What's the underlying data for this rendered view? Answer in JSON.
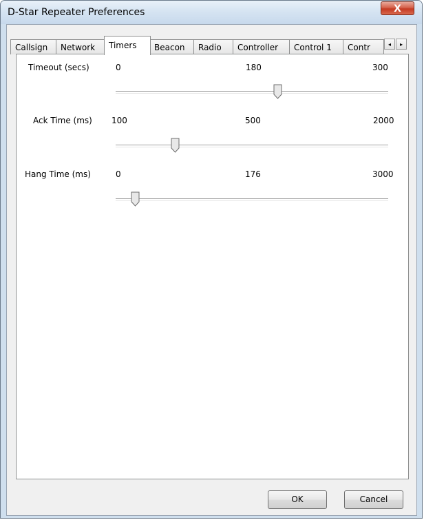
{
  "window": {
    "title": "D-Star Repeater Preferences"
  },
  "title_bar": {
    "close_glyph": "X"
  },
  "tabs": [
    {
      "label": "Callsign"
    },
    {
      "label": "Network"
    },
    {
      "label": "Timers"
    },
    {
      "label": "Beacon"
    },
    {
      "label": "Radio"
    },
    {
      "label": "Controller"
    },
    {
      "label": "Control 1"
    },
    {
      "label": "Contr"
    }
  ],
  "active_tab": "Timers",
  "tab_scroll": {
    "left_glyph": "◂",
    "right_glyph": "▸"
  },
  "timers": [
    {
      "label": "Timeout (secs)",
      "min": "0",
      "value": "180",
      "max": "300"
    },
    {
      "label": "Ack Time (ms)",
      "min": "100",
      "value": "500",
      "max": "2000"
    },
    {
      "label": "Hang Time (ms)",
      "min": "0",
      "value": "176",
      "max": "3000"
    }
  ],
  "buttons": {
    "ok": "OK",
    "cancel": "Cancel"
  }
}
